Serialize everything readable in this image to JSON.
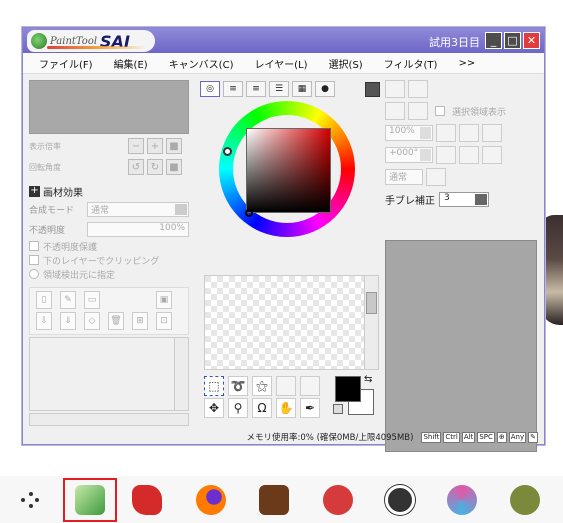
{
  "window": {
    "logo_text_small": "PaintTool",
    "logo_text_big": "SAI",
    "trial_label": "試用3日目",
    "min_glyph": "_",
    "max_glyph": "□",
    "close_glyph": "✕"
  },
  "menu": {
    "items": [
      "ファイル(F)",
      "編集(E)",
      "キャンバス(C)",
      "レイヤー(L)",
      "選択(S)",
      "フィルタ(T)",
      ">>"
    ]
  },
  "navigator": {
    "zoom_label": "表示倍率",
    "angle_label": "回転角度"
  },
  "layer_props": {
    "section_title": "画材効果",
    "blend_label": "合成モード",
    "blend_value": "通常",
    "opacity_label": "不透明度",
    "opacity_value": "100%",
    "check1": "不透明度保護",
    "check2": "下のレイヤーでクリッピング",
    "check3": "領域検出元に指定"
  },
  "right_panel": {
    "show_selection": "選択領域表示",
    "zoom_value": "100%",
    "angle_value": "+000°",
    "mode_value": "通常",
    "stabilizer_label": "手ブレ補正",
    "stabilizer_value": "3"
  },
  "status": {
    "memory_text": "メモリ使用率:0% (確保0MB/上限4095MB)",
    "keys": [
      "Shift",
      "Ctrl",
      "Alt",
      "SPC",
      "⊕",
      "Any",
      "✎"
    ]
  },
  "taskbar": {
    "items": [
      {
        "name": "apps-launcher-icon",
        "color": "#333333"
      },
      {
        "name": "painttool-sai-icon",
        "color": "#4aa34a",
        "active": true
      },
      {
        "name": "red-paint-app-icon",
        "color": "#d42a2a"
      },
      {
        "name": "firefox-icon",
        "color": "#ff7a00"
      },
      {
        "name": "brown-app-icon",
        "color": "#6b3a1a"
      },
      {
        "name": "red-triangle-app-icon",
        "color": "#d63b3b"
      },
      {
        "name": "obs-icon",
        "color": "#333333"
      },
      {
        "name": "pink-brush-app-icon",
        "color": "#e05aa8"
      },
      {
        "name": "gimp-icon",
        "color": "#7a8a3a"
      }
    ]
  }
}
